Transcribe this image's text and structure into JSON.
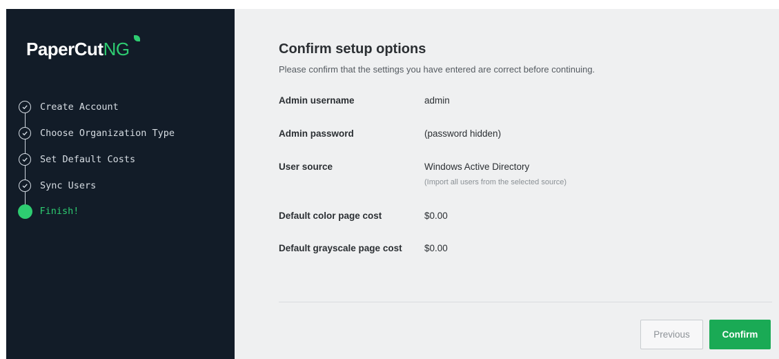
{
  "brand": {
    "logo_main": "PaperCut",
    "logo_suffix": "NG",
    "accent_color": "#2ecc71"
  },
  "steps": [
    {
      "label": "Create Account",
      "state": "done"
    },
    {
      "label": "Choose Organization Type",
      "state": "done"
    },
    {
      "label": "Set Default Costs",
      "state": "done"
    },
    {
      "label": "Sync Users",
      "state": "done"
    },
    {
      "label": "Finish!",
      "state": "active"
    }
  ],
  "main": {
    "title": "Confirm setup options",
    "subtitle": "Please confirm that the settings you have entered are correct before continuing.",
    "rows": [
      {
        "label": "Admin username",
        "value": "admin"
      },
      {
        "label": "Admin password",
        "value": "(password hidden)"
      },
      {
        "label": "User source",
        "value": "Windows Active Directory",
        "hint": "(Import all users from the selected source)"
      },
      {
        "label": "Default color page cost",
        "value": "$0.00"
      },
      {
        "label": "Default grayscale page cost",
        "value": "$0.00"
      }
    ]
  },
  "buttons": {
    "previous": "Previous",
    "confirm": "Confirm",
    "confirm_color": "#1aaa55"
  }
}
